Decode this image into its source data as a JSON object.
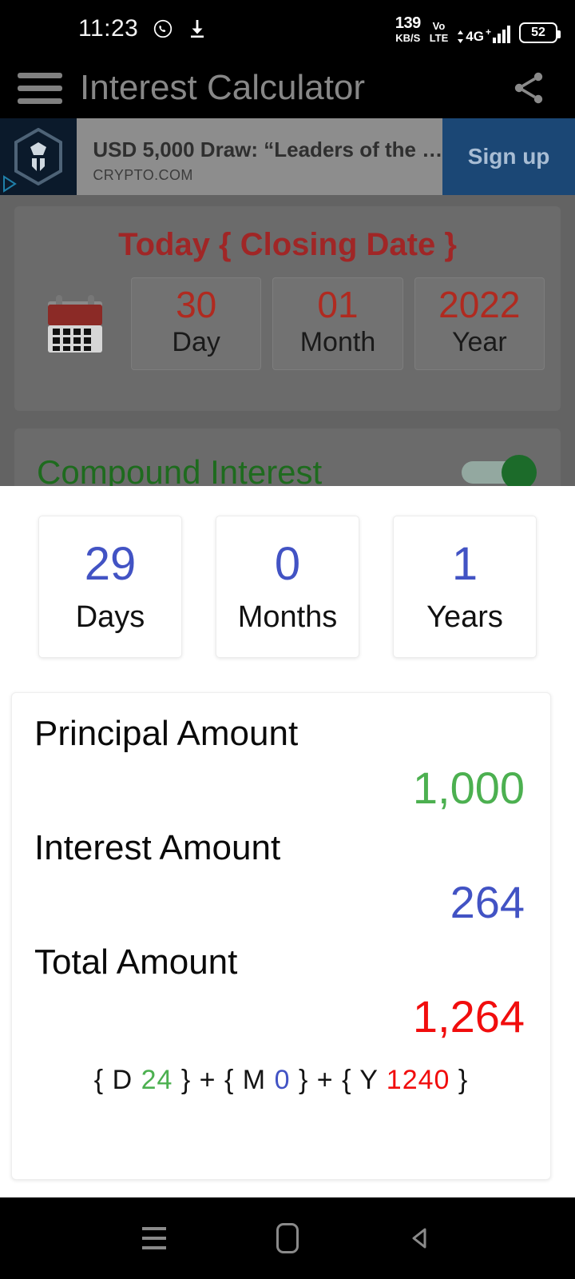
{
  "status_bar": {
    "time": "11:23",
    "icons": [
      "whatsapp-icon",
      "download-icon"
    ],
    "net_speed_value": "139",
    "net_speed_unit": "KB/S",
    "volte_line1": "Vo",
    "volte_line2": "LTE",
    "network_type": "4G",
    "battery_percent": "52"
  },
  "app_bar": {
    "title": "Interest Calculator",
    "menu_icon": "hamburger-icon",
    "share_icon": "share-icon"
  },
  "ad": {
    "headline": "USD 5,000 Draw: “Leaders of the …",
    "advertiser": "CRYPTO.COM",
    "cta_label": "Sign up",
    "brand_icon": "crypto-com-logo",
    "adchoices_icon": "adchoices-icon"
  },
  "closing_date_card": {
    "title": "Today { Closing Date }",
    "calendar_icon": "calendar-icon",
    "fields": [
      {
        "value": "30",
        "label": "Day"
      },
      {
        "value": "01",
        "label": "Month"
      },
      {
        "value": "2022",
        "label": "Year"
      }
    ]
  },
  "compound_section": {
    "label": "Compound Interest",
    "toggle_state": "on"
  },
  "duration": [
    {
      "value": "29",
      "label": "Days"
    },
    {
      "value": "0",
      "label": "Months"
    },
    {
      "value": "1",
      "label": "Years"
    }
  ],
  "results": [
    {
      "label": "Principal Amount",
      "value": "1,000"
    },
    {
      "label": "Interest Amount",
      "value": "264"
    },
    {
      "label": "Total Amount",
      "value": "1,264"
    }
  ],
  "breakdown": {
    "open_d": "{ D",
    "d_value": "24",
    "close_d": "}",
    "plus1": "+",
    "open_m": "{ M",
    "m_value": "0",
    "close_m": "}",
    "plus2": "+",
    "open_y": "{ Y",
    "y_value": "1240",
    "close_y": "}"
  },
  "nav_bar": {
    "recents_icon": "recents-icon",
    "home_icon": "home-icon",
    "back_icon": "back-icon"
  },
  "colors": {
    "principal": "#4cb050",
    "interest": "#4253c4",
    "total": "#f10d0d",
    "date_red": "#b02a20",
    "compound_green": "#1e6b1e",
    "cta_blue": "#1b4775"
  }
}
